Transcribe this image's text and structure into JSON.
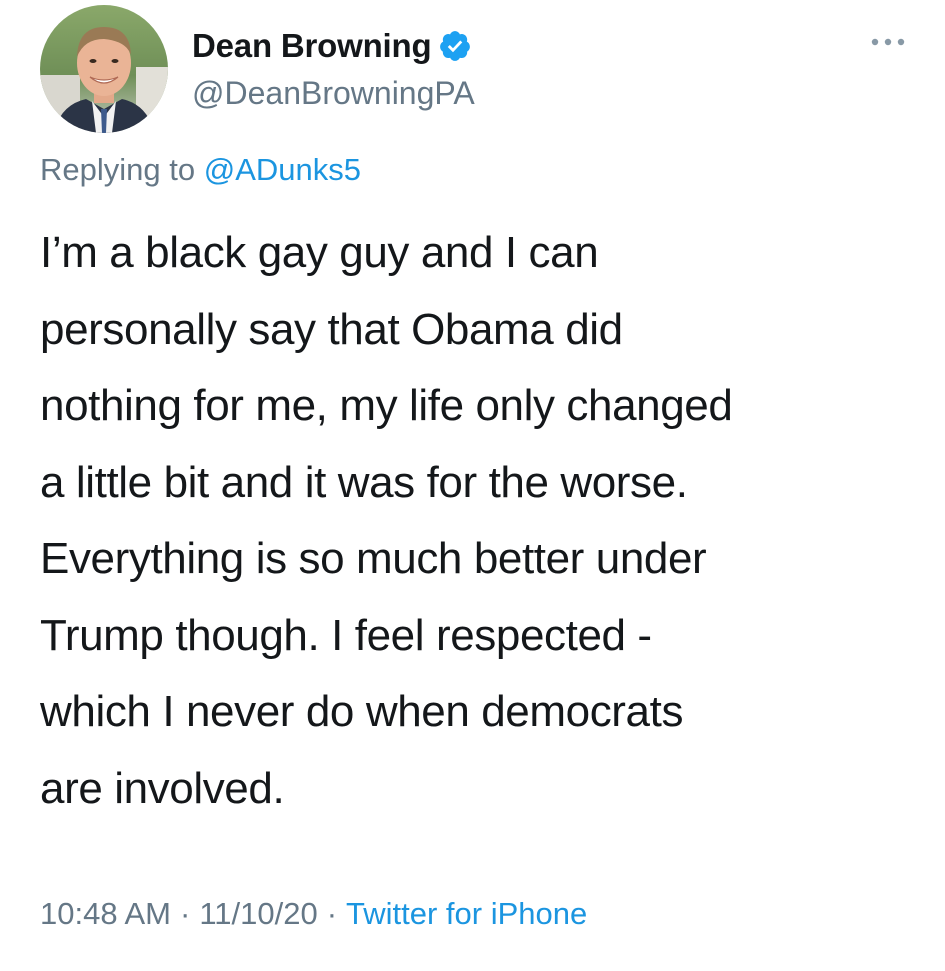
{
  "author": {
    "display_name": "Dean Browning",
    "handle": "@DeanBrowningPA",
    "verified": true,
    "avatar_icon": "profile-photo",
    "verified_icon": "verified-badge-icon"
  },
  "header": {
    "more_icon": "more-options-icon"
  },
  "reply": {
    "prefix": "Replying to",
    "to_handle": "@ADunks5"
  },
  "tweet": {
    "lines": [
      "I’m a black gay guy and I can",
      "personally say that Obama did",
      "nothing for me, my life only changed",
      "a little bit and it was for the worse.",
      "Everything is so much better under",
      "Trump though. I feel respected -",
      "which I never do when democrats",
      "are involved."
    ]
  },
  "meta": {
    "time": "10:48 AM",
    "separator": "·",
    "date": "11/10/20",
    "source": "Twitter for iPhone"
  },
  "colors": {
    "link": "#1b95e0",
    "secondary_text": "#657786",
    "primary_text": "#14171a",
    "verified": "#1da1f2"
  }
}
